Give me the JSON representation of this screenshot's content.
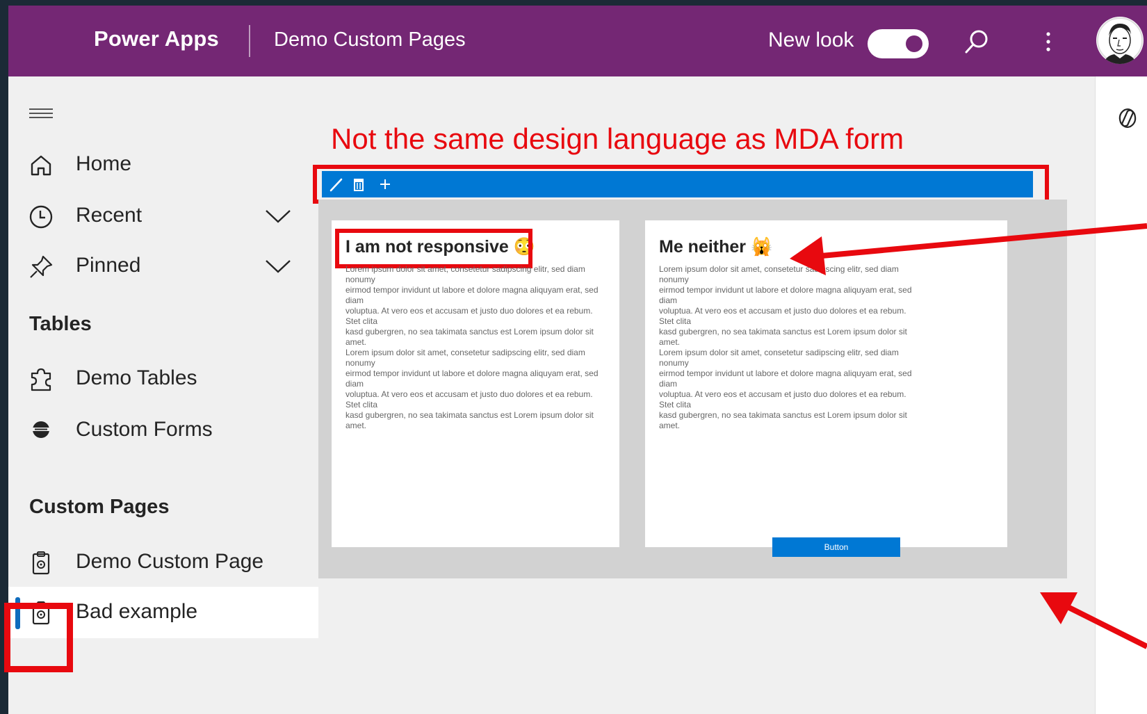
{
  "header": {
    "brand": "Power Apps",
    "app_name": "Demo Custom Pages",
    "new_look_label": "New look",
    "new_look_on": true,
    "accent": "#742774"
  },
  "sidebar": {
    "items": [
      {
        "label": "Home",
        "icon": "home-icon"
      },
      {
        "label": "Recent",
        "icon": "clock-icon",
        "expandable": true
      },
      {
        "label": "Pinned",
        "icon": "pin-icon",
        "expandable": true
      }
    ],
    "sections": [
      {
        "title": "Tables",
        "items": [
          {
            "label": "Demo Tables",
            "icon": "puzzle-icon"
          },
          {
            "label": "Custom Forms",
            "icon": "globe-icon"
          }
        ]
      },
      {
        "title": "Custom Pages",
        "items": [
          {
            "label": "Demo Custom Page",
            "icon": "clipboard-gear-icon"
          },
          {
            "label": "Bad example",
            "icon": "clipboard-gear-icon",
            "selected": true
          }
        ]
      }
    ]
  },
  "main": {
    "annotation": "Not the same design language as MDA form",
    "toolbar": {
      "icons": [
        "edit-icon",
        "delete-icon",
        "add-icon"
      ],
      "color": "#0078d4"
    },
    "cards": [
      {
        "title": "I am not responsive 😳",
        "lines": [
          "Lorem ipsum dolor sit amet, consetetur sadipscing elitr, sed diam nonumy",
          "eirmod tempor invidunt ut labore et dolore magna aliquyam erat, sed diam",
          "voluptua. At vero eos et accusam et justo duo dolores et ea rebum. Stet clita",
          "kasd gubergren, no sea takimata sanctus est Lorem ipsum dolor sit amet.",
          "Lorem ipsum dolor sit amet, consetetur sadipscing elitr, sed diam nonumy",
          "eirmod tempor invidunt ut labore et dolore magna aliquyam erat, sed diam",
          "voluptua. At vero eos et accusam et justo duo dolores et ea rebum. Stet clita",
          "kasd gubergren, no sea takimata sanctus est Lorem ipsum dolor sit amet."
        ]
      },
      {
        "title": "Me neither 🙀",
        "lines": [
          "Lorem ipsum dolor sit amet, consetetur sadipscing elitr, sed diam nonumy",
          "eirmod tempor invidunt ut labore et dolore magna aliquyam erat, sed diam",
          "voluptua. At vero eos et accusam et justo duo dolores et ea rebum. Stet clita",
          "kasd gubergren, no sea takimata sanctus est Lorem ipsum dolor sit amet.",
          "Lorem ipsum dolor sit amet, consetetur sadipscing elitr, sed diam nonumy",
          "eirmod tempor invidunt ut labore et dolore magna aliquyam erat, sed diam",
          "voluptua. At vero eos et accusam et justo duo dolores et ea rebum. Stet clita",
          "kasd gubergren, no sea takimata sanctus est Lorem ipsum dolor sit amet."
        ],
        "button_label": "Button"
      }
    ]
  },
  "annotation_color": "#e8090f"
}
